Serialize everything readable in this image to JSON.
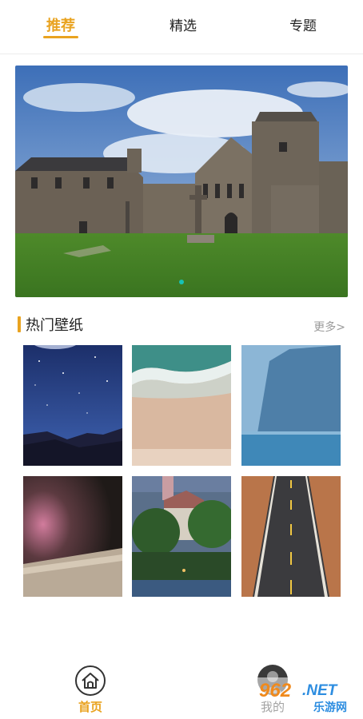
{
  "tabs": [
    {
      "label": "推荐",
      "active": true
    },
    {
      "label": "精选",
      "active": false
    },
    {
      "label": "专题",
      "active": false
    }
  ],
  "banner": {
    "description": "carousel-photo",
    "dot_count": 1,
    "active_dot": 0
  },
  "section": {
    "title": "热门壁纸",
    "more_label": "更多>"
  },
  "wallpapers": [
    {
      "subject": "starry night over mountains"
    },
    {
      "subject": "aerial beach with waves"
    },
    {
      "subject": "misty cliff over sea"
    },
    {
      "subject": "blurred open book"
    },
    {
      "subject": "village church at dusk"
    },
    {
      "subject": "straight road in desert"
    }
  ],
  "bottom_nav": {
    "home_label": "首页",
    "home_icon": "home-icon",
    "mine_label": "我的",
    "mine_icon": "avatar-icon"
  },
  "watermark": {
    "text_top": "962.NET",
    "text_bottom": "乐游网"
  },
  "colors": {
    "accent": "#e9a320",
    "indicator": "#17c2b5"
  }
}
